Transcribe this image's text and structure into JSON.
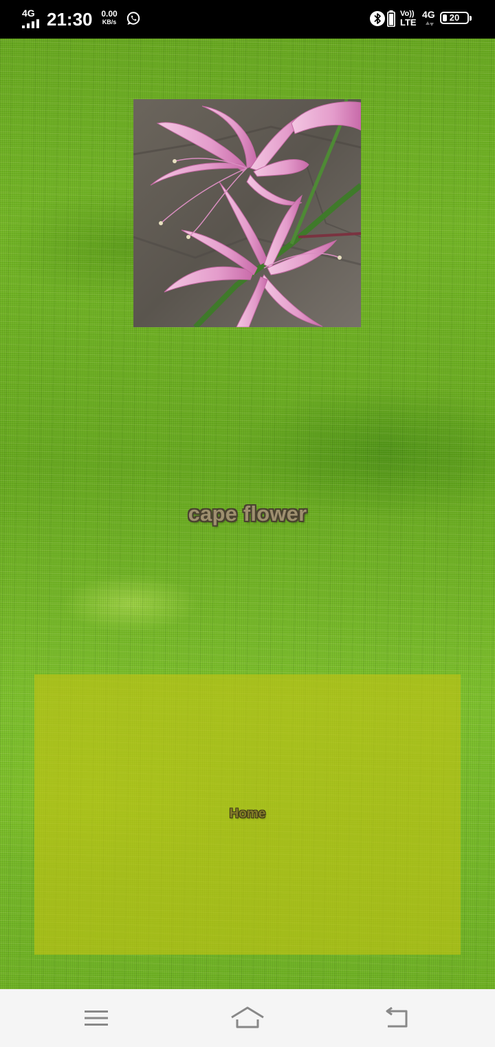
{
  "status_bar": {
    "network_type": "4G",
    "time": "21:30",
    "net_speed_value": "0.00",
    "net_speed_unit": "KB/s",
    "volte_top": "Vo))",
    "volte_bottom": "LTE",
    "mobile_data": "4G",
    "battery_level": "20",
    "icons": [
      "signal-icon",
      "whatsapp-icon",
      "bluetooth-icon",
      "battery-icon"
    ]
  },
  "main": {
    "title": "cape flower",
    "home_label": "Home",
    "image_subject": "pink nerine flower"
  },
  "nav_bar": {
    "icons": [
      "menu-icon",
      "home-icon",
      "back-icon"
    ]
  },
  "colors": {
    "background_green": "#6db022",
    "home_panel": "#c3c314",
    "title_fill": "#9e8f6f",
    "title_outline": "#4a4230",
    "nav_bar_bg": "#f5f5f5",
    "nav_icon": "#888888"
  }
}
